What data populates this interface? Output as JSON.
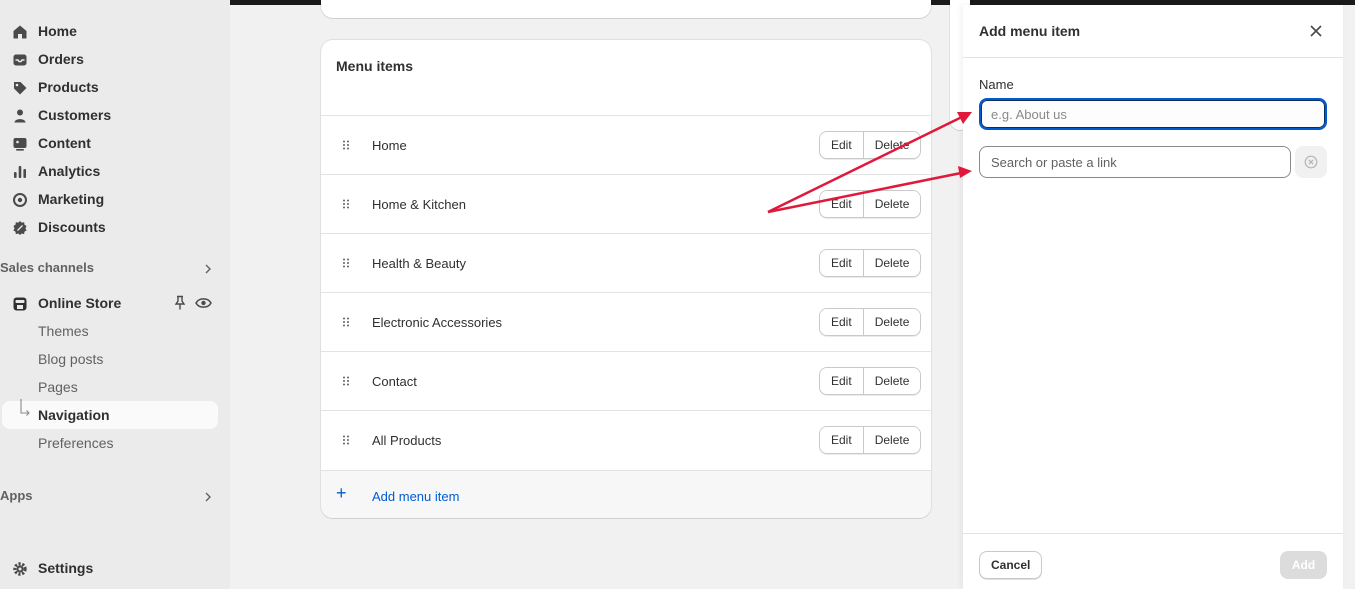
{
  "sidebar": {
    "main_items": [
      {
        "label": "Home",
        "icon": "home-icon"
      },
      {
        "label": "Orders",
        "icon": "inbox-icon"
      },
      {
        "label": "Products",
        "icon": "tag-icon"
      },
      {
        "label": "Customers",
        "icon": "person-icon"
      },
      {
        "label": "Content",
        "icon": "image-icon"
      },
      {
        "label": "Analytics",
        "icon": "bar-chart-icon"
      },
      {
        "label": "Marketing",
        "icon": "target-icon"
      },
      {
        "label": "Discounts",
        "icon": "discount-icon"
      }
    ],
    "sales_channels_label": "Sales channels",
    "online_store": {
      "label": "Online Store",
      "icon": "store-icon"
    },
    "online_store_subitems": [
      {
        "label": "Themes"
      },
      {
        "label": "Blog posts"
      },
      {
        "label": "Pages"
      },
      {
        "label": "Navigation",
        "active": true
      },
      {
        "label": "Preferences"
      }
    ],
    "apps_label": "Apps",
    "settings": {
      "label": "Settings",
      "icon": "gear-icon"
    }
  },
  "menu_card": {
    "title": "Menu items",
    "items": [
      {
        "name": "Home"
      },
      {
        "name": "Home & Kitchen"
      },
      {
        "name": "Health & Beauty"
      },
      {
        "name": "Electronic Accessories"
      },
      {
        "name": "Contact"
      },
      {
        "name": "All Products"
      }
    ],
    "edit_label": "Edit",
    "delete_label": "Delete",
    "add_label": "Add menu item"
  },
  "panel": {
    "title": "Add menu item",
    "name_label": "Name",
    "name_placeholder": "e.g. About us",
    "link_placeholder": "Search or paste a link",
    "cancel_label": "Cancel",
    "add_label": "Add"
  },
  "colors": {
    "accent": "#005bd3",
    "annotation_arrow": "#e0193a"
  }
}
